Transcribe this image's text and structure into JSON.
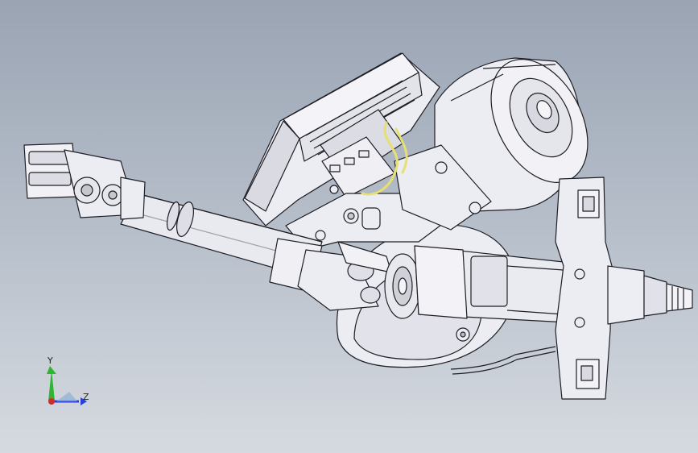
{
  "viewport": {
    "background_top": "#9aa4b3",
    "background_bottom": "#d6dae0"
  },
  "model": {
    "description_icon": "steering-column-assembly-icon",
    "body_color": "#ecedf3",
    "edge_color": "#1e1e24",
    "wire_color": "#e6e070"
  },
  "triad": {
    "y_label": "Y",
    "z_label": "Z",
    "y_color": "#2fb52f",
    "z_color": "#2a3fd6",
    "x_color": "#d42a2a"
  }
}
